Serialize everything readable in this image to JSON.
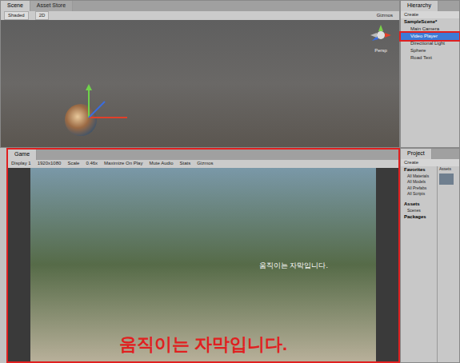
{
  "scene": {
    "tabs": [
      {
        "label": "Scene",
        "selected": true
      },
      {
        "label": "Asset Store",
        "selected": false
      }
    ],
    "toolbar_left": [
      "Shaded",
      "2D"
    ],
    "toolbar_right": [
      "Gizmos"
    ],
    "gizmo_label": "Persp"
  },
  "hierarchy": {
    "title": "Hierarchy",
    "create": "Create",
    "scene": "SampleScene*",
    "items": [
      {
        "label": "Main Camera",
        "selected": false
      },
      {
        "label": "Video Player",
        "selected": true
      },
      {
        "label": "Directional Light",
        "selected": false
      },
      {
        "label": "Sphere",
        "selected": false
      },
      {
        "label": "Road Text",
        "selected": false
      }
    ]
  },
  "game": {
    "tab": "Game",
    "toolbar": [
      "Display 1",
      "1920x1080",
      "Scale",
      "0.46x",
      "Maximize On Play",
      "Mute Audio",
      "Stats",
      "Gizmos"
    ],
    "subtitle": "움직이는 자막입니다.",
    "annotation": "움직이는 자막입니다."
  },
  "project": {
    "title": "Project",
    "create": "Create",
    "favorites": {
      "label": "Favorites",
      "items": [
        "All Materials",
        "All Models",
        "All Prefabs",
        "All Scripts"
      ]
    },
    "assets": {
      "label": "Assets",
      "items": [
        "Scenes"
      ]
    },
    "packages": "Packages",
    "grid_header": "Assets"
  }
}
